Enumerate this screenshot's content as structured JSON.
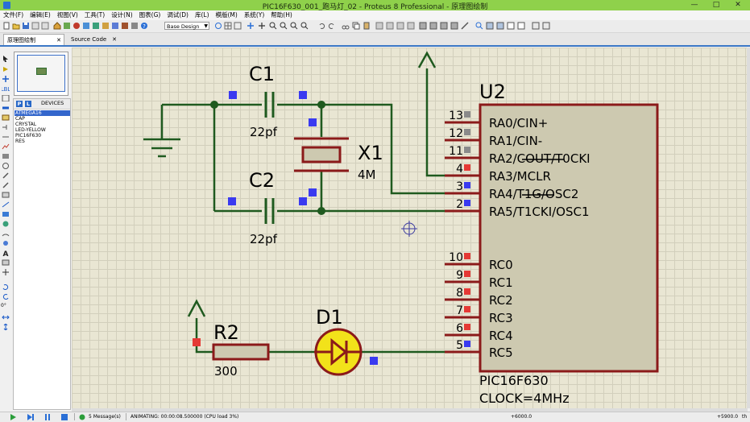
{
  "window": {
    "title": "PIC16F630_001_跑马灯_02 - Proteus 8 Professional - 原理图绘制",
    "min": "—",
    "max": "□",
    "close": "✕"
  },
  "menu": [
    "文件(F)",
    "编辑(E)",
    "视图(V)",
    "工具(T)",
    "设计(N)",
    "图表(G)",
    "调试(D)",
    "库(L)",
    "模版(M)",
    "系统(Y)",
    "帮助(H)"
  ],
  "toolbar": {
    "variant": "Base Design"
  },
  "tabs": [
    {
      "label": "原理图绘制",
      "close": "✕"
    },
    {
      "label": "Source Code",
      "close": "✕"
    }
  ],
  "left_panel": {
    "p_label": "P",
    "l_label": "L",
    "title": "DEVICES",
    "devices": [
      "ATMEGA16",
      "CAP",
      "CRYSTAL",
      "LED-YELLOW",
      "PIC16F630",
      "RES"
    ],
    "selected": 0,
    "rotation": "0°"
  },
  "schematic": {
    "colors": {
      "wire": "#1f5a1f",
      "body": "#8b1a1a",
      "fill": "#cdc9b0",
      "led": "#f2e21a",
      "pin_red": "#e53935",
      "pin_blue": "#3a3af0",
      "pin_gray": "#8a8a8a"
    },
    "c1": {
      "ref": "C1",
      "value": "22pf"
    },
    "c2": {
      "ref": "C2",
      "value": "22pf"
    },
    "x1": {
      "ref": "X1",
      "value": "4M"
    },
    "r2": {
      "ref": "R2",
      "value": "300"
    },
    "d1": {
      "ref": "D1"
    },
    "u2": {
      "ref": "U2",
      "part": "PIC16F630",
      "clock": "CLOCK=4MHz",
      "pins": [
        {
          "num": "13",
          "name": "RA0/CIN+"
        },
        {
          "num": "12",
          "name": "RA1/CIN-"
        },
        {
          "num": "11",
          "name": "RA2/COUT/T0CKI"
        },
        {
          "num": "4",
          "name": "RA3/MCLR"
        },
        {
          "num": "3",
          "name": "RA4/T1G/OSC2"
        },
        {
          "num": "2",
          "name": "RA5/T1CKI/OSC1"
        },
        {
          "num": "10",
          "name": "RC0"
        },
        {
          "num": "9",
          "name": "RC1"
        },
        {
          "num": "8",
          "name": "RC2"
        },
        {
          "num": "7",
          "name": "RC3"
        },
        {
          "num": "6",
          "name": "RC4"
        },
        {
          "num": "5",
          "name": "RC5"
        }
      ]
    }
  },
  "status": {
    "messages": "5 Message(s)",
    "animating": "ANIMATING: 00:00:08.500000 (CPU load 3%)",
    "coord_x": "+6000.0",
    "coord_y": "+5900.0",
    "unit": "th"
  }
}
